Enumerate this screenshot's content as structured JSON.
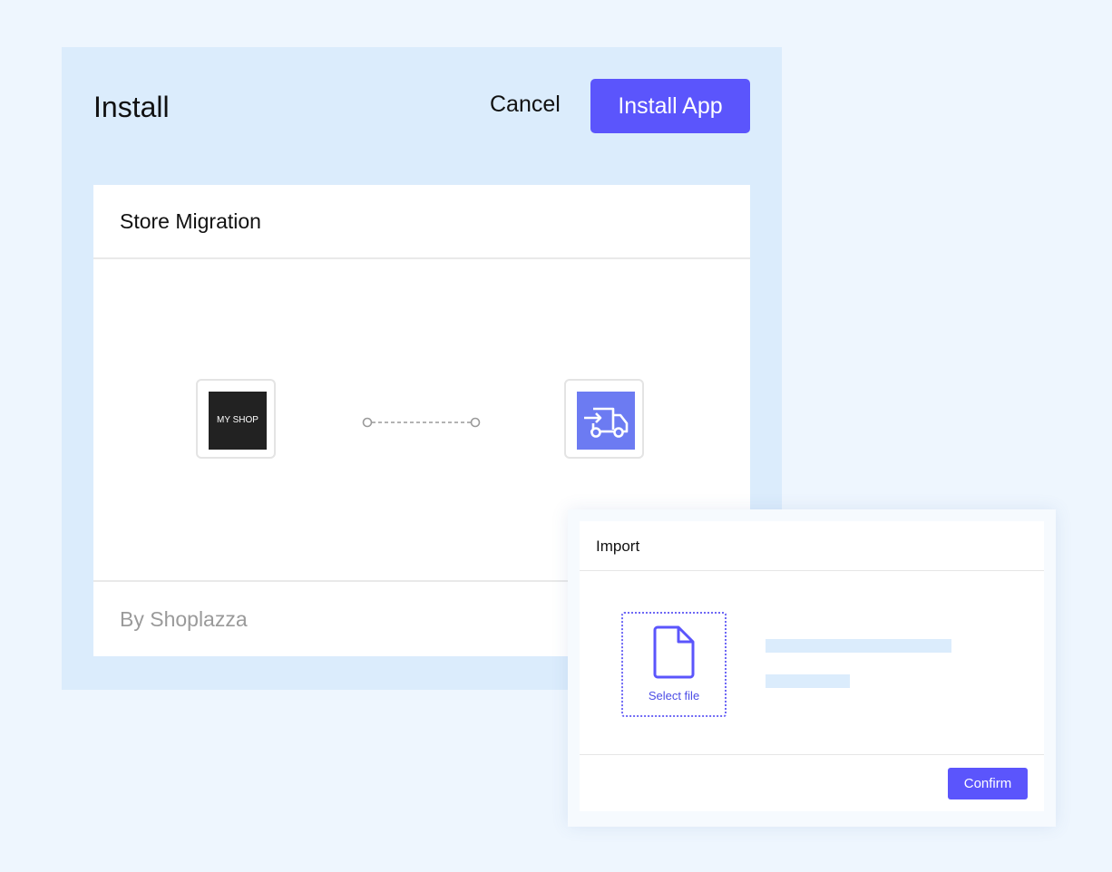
{
  "install": {
    "title": "Install",
    "cancel_label": "Cancel",
    "install_app_label": "Install App"
  },
  "migration": {
    "title": "Store Migration",
    "source_logo_text": "MY SHOP",
    "source_icon": "shop-logo",
    "target_icon": "delivery-truck-icon",
    "byline": "By Shoplazza"
  },
  "import_dialog": {
    "title": "Import",
    "select_file_label": "Select file",
    "confirm_label": "Confirm"
  },
  "colors": {
    "accent": "#5b55fc",
    "panel_background": "#dbecfc",
    "page_background": "#eef6fe",
    "truck_tile": "#6c7bf2"
  }
}
